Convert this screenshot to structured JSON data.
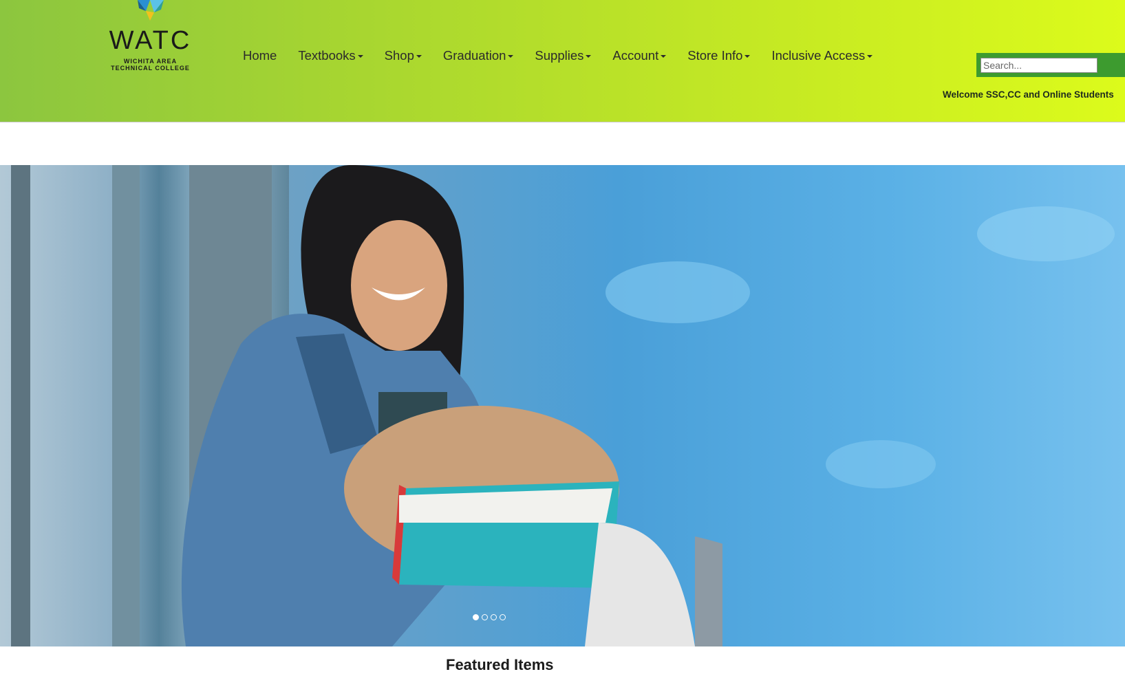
{
  "logo": {
    "word": "WATC",
    "line1": "WICHITA AREA",
    "line2": "TECHNICAL COLLEGE"
  },
  "nav": {
    "items": [
      {
        "label": "Home",
        "dropdown": false
      },
      {
        "label": "Textbooks",
        "dropdown": true
      },
      {
        "label": "Shop",
        "dropdown": true
      },
      {
        "label": "Graduation",
        "dropdown": true
      },
      {
        "label": "Supplies",
        "dropdown": true
      },
      {
        "label": "Account",
        "dropdown": true
      },
      {
        "label": "Store Info",
        "dropdown": true
      },
      {
        "label": "Inclusive Access",
        "dropdown": true
      }
    ]
  },
  "search": {
    "placeholder": "Search...",
    "value": ""
  },
  "welcome": "Welcome SSC,CC and Online Students",
  "carousel": {
    "slide_count": 4,
    "active_index": 0
  },
  "section": {
    "featured_title": "Featured Items"
  },
  "colors": {
    "header_start": "#8cc63f",
    "header_end": "#dcfb1b",
    "search_frame": "#3d9b2f"
  }
}
